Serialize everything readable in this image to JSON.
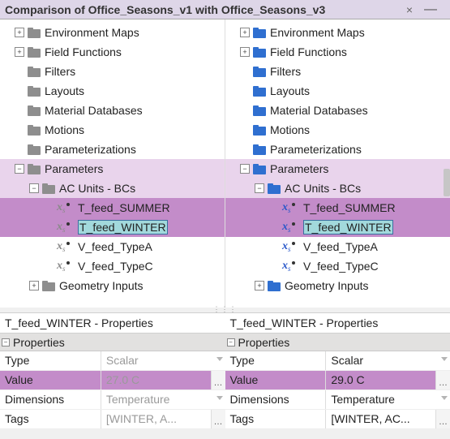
{
  "title": "Comparison of Office_Seasons_v1 with Office_Seasons_v3",
  "tree_common": {
    "n0": "Environment Maps",
    "n1": "Field Functions",
    "n2": "Filters",
    "n3": "Layouts",
    "n4": "Material Databases",
    "n5": "Motions",
    "n6": "Parameterizations",
    "n7": "Parameters",
    "n8": "AC Units - BCs",
    "n9": "T_feed_SUMMER",
    "n10": "T_feed_WINTER",
    "n11": "V_feed_TypeA",
    "n12": "V_feed_TypeC",
    "n13": "Geometry Inputs"
  },
  "props_title": "T_feed_WINTER - Properties",
  "section": "Properties",
  "rows": {
    "type": "Type",
    "value": "Value",
    "dimensions": "Dimensions",
    "tags": "Tags"
  },
  "left": {
    "type": "Scalar",
    "value": "27.0 C",
    "dimensions": "Temperature",
    "tags": "[WINTER, A..."
  },
  "right": {
    "type": "Scalar",
    "value": "29.0 C",
    "dimensions": "Temperature",
    "tags": "[WINTER, AC..."
  }
}
